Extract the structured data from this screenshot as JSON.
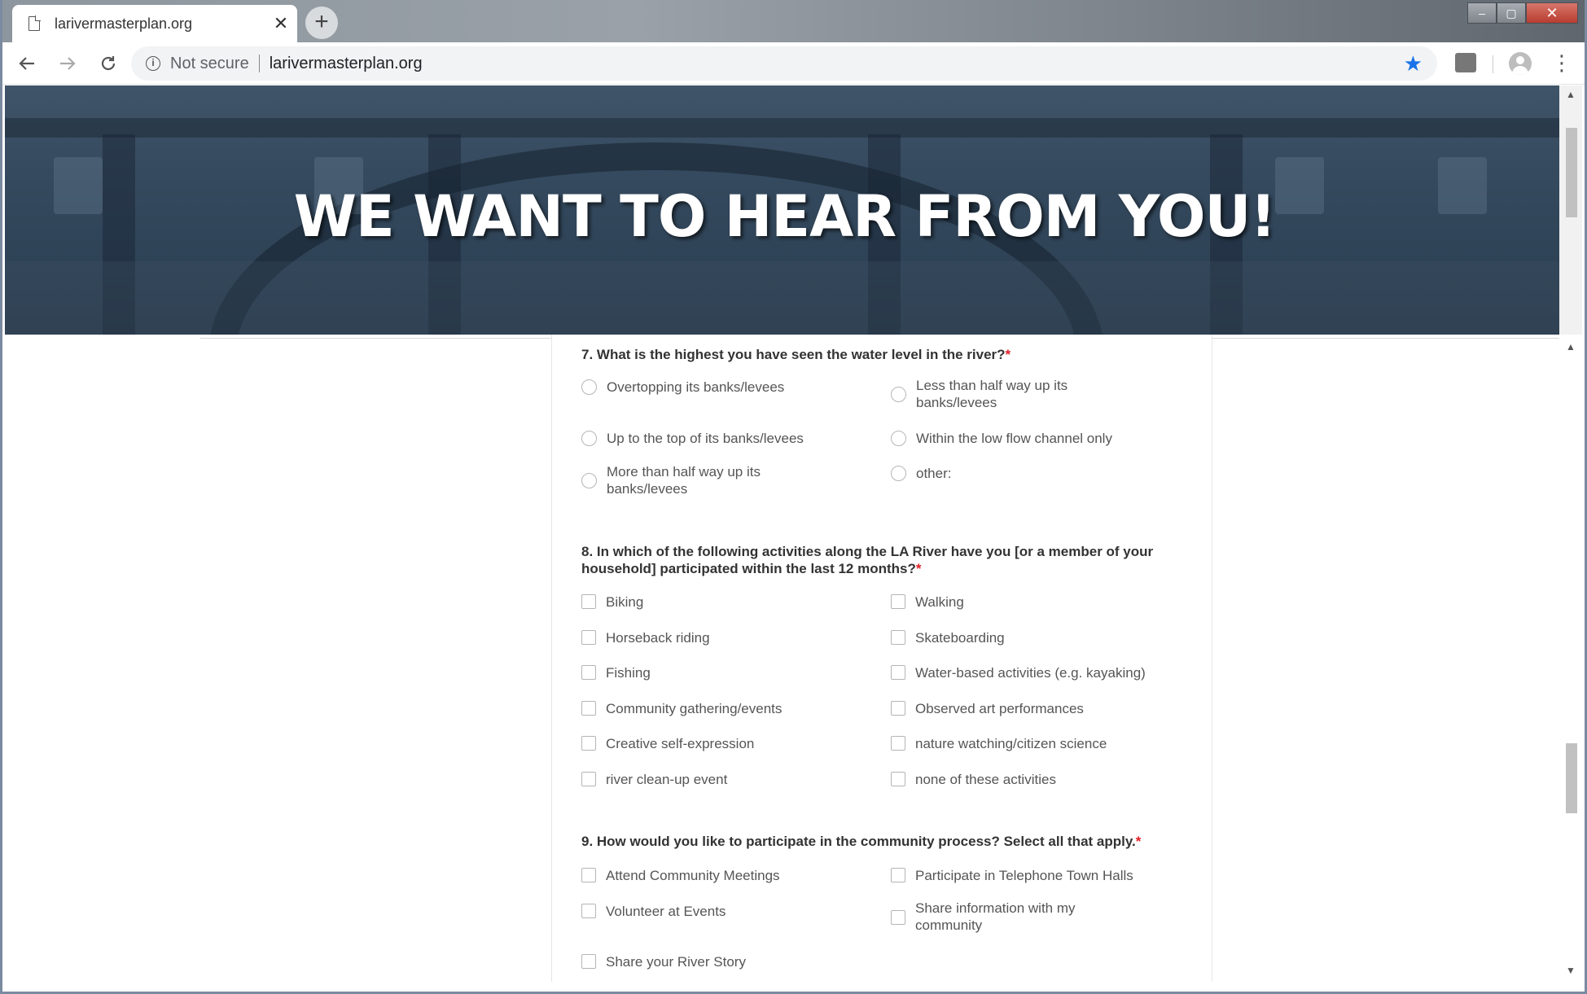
{
  "browser": {
    "tab_title": "larivermasterplan.org",
    "tab_close": "✕",
    "new_tab": "+",
    "security_label": "Not secure",
    "url": "larivermasterplan.org",
    "window_controls": {
      "minimize": "–",
      "maximize": "▢",
      "close": "✕"
    }
  },
  "hero": {
    "heading": "WE WANT TO HEAR FROM YOU!"
  },
  "form": {
    "q7": {
      "title": "7. What is the highest you have seen the water level in the river?",
      "required_mark": "*",
      "options": [
        "Overtopping its banks/levees",
        "Less than half way up its banks/levees",
        "Up to the top of its banks/levees",
        "Within the low flow channel only",
        "More than half way up its banks/levees",
        "other:"
      ]
    },
    "q8": {
      "title": "8. In which of the following activities along the LA River have you [or a member of your household] participated within the last 12 months?",
      "required_mark": "*",
      "options": [
        "Biking",
        "Walking",
        "Horseback riding",
        "Skateboarding",
        "Fishing",
        "Water-based activities (e.g. kayaking)",
        "Community gathering/events",
        "Observed art performances",
        "Creative self-expression",
        "nature watching/citizen science",
        "river clean-up event",
        "none of these activities"
      ]
    },
    "q9": {
      "title": "9. How would you like to participate in the community process? Select all that apply.",
      "required_mark": "*",
      "options": [
        "Attend Community Meetings",
        "Participate in Telephone Town Halls",
        "Volunteer at Events",
        "Share information with my community",
        "Share your River Story"
      ]
    }
  },
  "colors": {
    "required": "#e31c24",
    "bookmark_star": "#1a73e8",
    "hero_overlay": "#354a5e"
  },
  "icons": [
    "page-icon",
    "close-icon",
    "plus-icon",
    "back-icon",
    "forward-icon",
    "reload-icon",
    "info-icon",
    "star-icon",
    "extension-icon",
    "profile-icon",
    "more-icon"
  ]
}
